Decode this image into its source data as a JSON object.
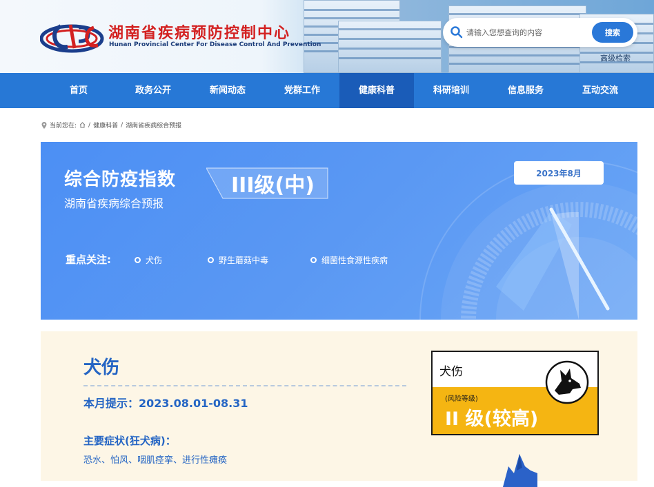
{
  "header": {
    "title": "湖南省疾病预防控制中心",
    "subtitle": "Hunan Provincial Center For Disease Control And Prevention",
    "search_placeholder": "请输入您想查询的内容",
    "search_button": "搜索",
    "advanced_search": "高级检索"
  },
  "nav": {
    "items": [
      {
        "label": "首页"
      },
      {
        "label": "政务公开"
      },
      {
        "label": "新闻动态"
      },
      {
        "label": "党群工作"
      },
      {
        "label": "健康科普"
      },
      {
        "label": "科研培训"
      },
      {
        "label": "信息服务"
      },
      {
        "label": "互动交流"
      }
    ],
    "active": "健康科普"
  },
  "breadcrumb": {
    "prefix": "当前您在:",
    "items": [
      "健康科普",
      "湖南省疾病综合预报"
    ],
    "separator": "/"
  },
  "banner": {
    "title": "综合防疫指数",
    "subtitle": "湖南省疾病综合预报",
    "level": "III级(中)",
    "date": "2023年8月",
    "focus_label": "重点关注:",
    "focus_items": [
      "犬伤",
      "野生蘑菇中毒",
      "细菌性食源性疾病"
    ]
  },
  "detail": {
    "title": "犬伤",
    "month_tip": "本月提示：2023.08.01-08.31",
    "symptoms_heading": "主要症状(狂犬病)：",
    "symptoms_text": "恐水、怕风、咽肌痉挛、进行性瘫痪",
    "risk_card": {
      "name": "犬伤",
      "label": "(风险等级)",
      "level": "II 级(较高)"
    }
  },
  "colors": {
    "nav_bg": "#2778d6",
    "nav_active": "#1a5cb8",
    "banner_bg": "#5a98f3",
    "accent_blue": "#2565c4",
    "risk_yellow": "#f5b512",
    "title_red": "#d32121"
  }
}
